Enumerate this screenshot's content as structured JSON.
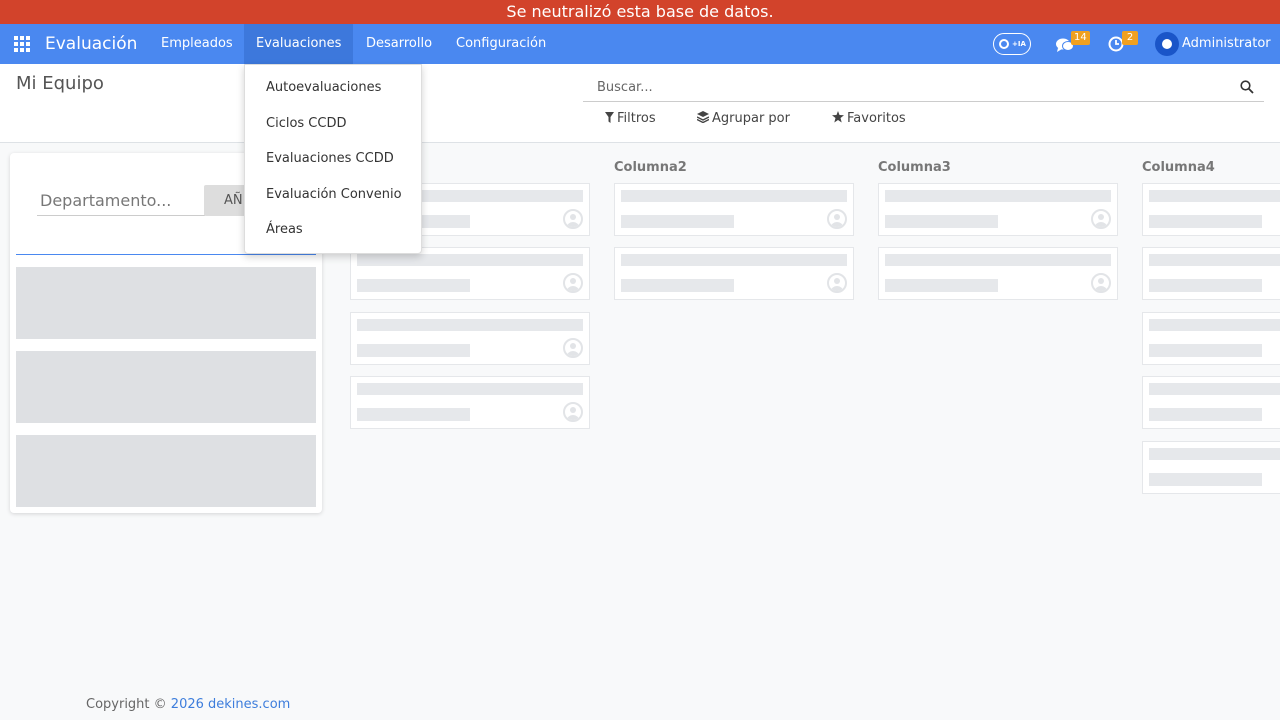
{
  "banner": {
    "text": "Se neutralizó esta base de datos."
  },
  "navbar": {
    "brand": "Evaluación",
    "menu": [
      {
        "label": "Empleados"
      },
      {
        "label": "Evaluaciones"
      },
      {
        "label": "Desarrollo"
      },
      {
        "label": "Configuración"
      }
    ],
    "ai_toggle_label": "IA",
    "messages_count": "14",
    "activities_count": "2",
    "user_name": "Administrator",
    "accent_color": "#4a88f0"
  },
  "banner_color": "#d2432b",
  "control_panel": {
    "title": "Mi Equipo",
    "search_placeholder": "Buscar...",
    "filters_label": "Filtros",
    "group_by_label": "Agrupar por",
    "favorites_label": "Favoritos"
  },
  "dropdown": {
    "items": [
      {
        "label": "Autoevaluaciones"
      },
      {
        "label": "Ciclos CCDD"
      },
      {
        "label": "Evaluaciones CCDD"
      },
      {
        "label": "Evaluación Convenio"
      },
      {
        "label": "Áreas"
      }
    ]
  },
  "department_panel": {
    "input_placeholder": "Departamento...",
    "add_button_label": "AÑ"
  },
  "kanban": {
    "columns": [
      {
        "title": ""
      },
      {
        "title": "Columna2"
      },
      {
        "title": "Columna3"
      },
      {
        "title": "Columna4"
      }
    ]
  },
  "footer": {
    "prefix": "Copyright © ",
    "link_text": "2026 dekines.com"
  }
}
